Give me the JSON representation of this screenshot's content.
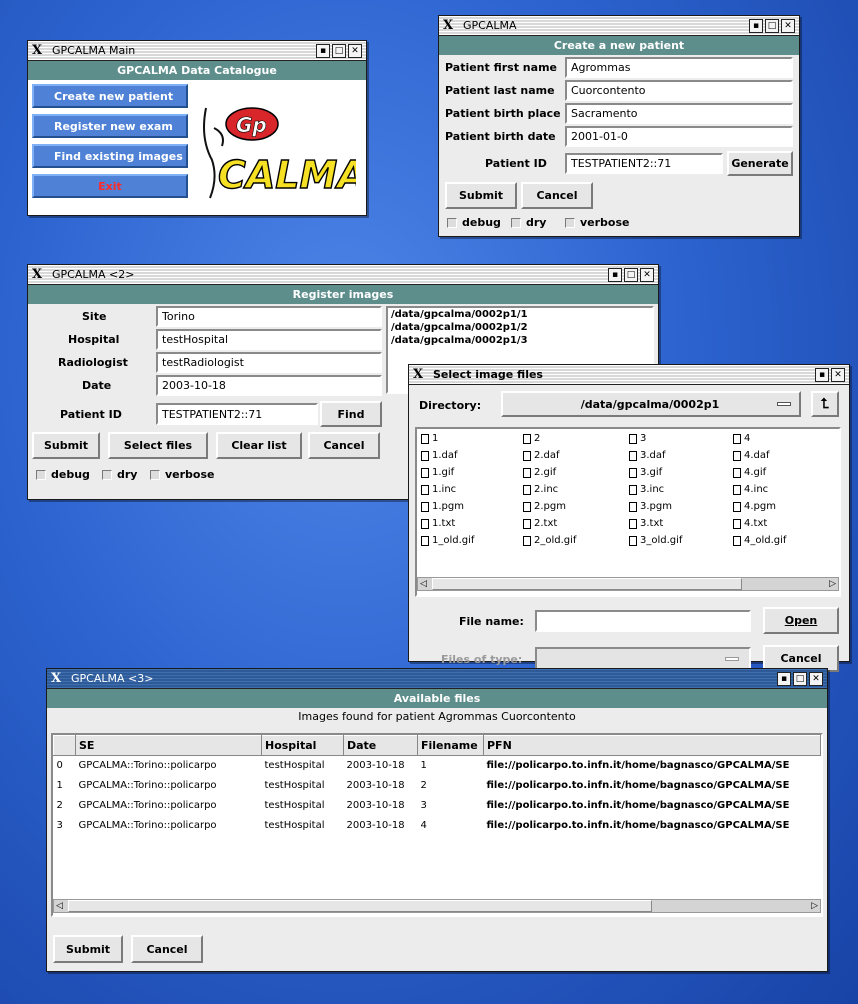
{
  "main_window": {
    "title": "GPCALMA Main",
    "band": "GPCALMA Data Catalogue",
    "buttons": [
      "Create new patient",
      "Register new exam",
      "Find existing images",
      "Exit"
    ],
    "logo_text": [
      "Gp",
      "CALMA"
    ]
  },
  "create_patient": {
    "title": "GPCALMA",
    "band": "Create a new patient",
    "fields": [
      {
        "label": "Patient first name",
        "value": "Agrommas"
      },
      {
        "label": "Patient last name",
        "value": "Cuorcontento"
      },
      {
        "label": "Patient birth place",
        "value": "Sacramento"
      },
      {
        "label": "Patient birth date",
        "value": "2001-01-0"
      }
    ],
    "patient_id": {
      "label": "Patient ID",
      "value": "TESTPATIENT2::71"
    },
    "generate_label": "Generate",
    "submit_label": "Submit",
    "cancel_label": "Cancel",
    "checks": [
      "debug",
      "dry",
      "verbose"
    ]
  },
  "register_images": {
    "title": "GPCALMA <2>",
    "band": "Register images",
    "fields": [
      {
        "label": "Site",
        "value": "Torino"
      },
      {
        "label": "Hospital",
        "value": "testHospital"
      },
      {
        "label": "Radiologist",
        "value": "testRadiologist"
      },
      {
        "label": "Date",
        "value": "2003-10-18"
      }
    ],
    "patient_id": {
      "label": "Patient ID",
      "value": "TESTPATIENT2::71"
    },
    "find_label": "Find",
    "files": [
      "/data/gpcalma/0002p1/1",
      "/data/gpcalma/0002p1/2",
      "/data/gpcalma/0002p1/3"
    ],
    "buttons": [
      "Submit",
      "Select files",
      "Clear list",
      "Cancel"
    ],
    "checks": [
      "debug",
      "dry",
      "verbose"
    ]
  },
  "select_files": {
    "title": "Select image files",
    "directory_label": "Directory:",
    "directory_value": "/data/gpcalma/0002p1",
    "columns": [
      [
        "1",
        "1.daf",
        "1.gif",
        "1.inc",
        "1.pgm",
        "1.txt",
        "1_old.gif"
      ],
      [
        "2",
        "2.daf",
        "2.gif",
        "2.inc",
        "2.pgm",
        "2.txt",
        "2_old.gif"
      ],
      [
        "3",
        "3.daf",
        "3.gif",
        "3.inc",
        "3.pgm",
        "3.txt",
        "3_old.gif"
      ],
      [
        "4",
        "4.daf",
        "4.gif",
        "4.inc",
        "4.pgm",
        "4.txt",
        "4_old.gif"
      ]
    ],
    "file_name_label": "File name:",
    "file_name_value": "",
    "files_of_type_label": "Files of type:",
    "open_label": "Open",
    "cancel_label": "Cancel"
  },
  "available_files": {
    "title": "GPCALMA <3>",
    "band": "Available files",
    "subtitle": "Images found for patient Agrommas Cuorcontento",
    "headers": [
      "",
      "SE",
      "Hospital",
      "Date",
      "Filename",
      "PFN"
    ],
    "rows": [
      [
        "0",
        "GPCALMA::Torino::policarpo",
        "testHospital",
        "2003-10-18",
        "1",
        "file://policarpo.to.infn.it/home/bagnasco/GPCALMA/SE"
      ],
      [
        "1",
        "GPCALMA::Torino::policarpo",
        "testHospital",
        "2003-10-18",
        "2",
        "file://policarpo.to.infn.it/home/bagnasco/GPCALMA/SE"
      ],
      [
        "2",
        "GPCALMA::Torino::policarpo",
        "testHospital",
        "2003-10-18",
        "3",
        "file://policarpo.to.infn.it/home/bagnasco/GPCALMA/SE"
      ],
      [
        "3",
        "GPCALMA::Torino::policarpo",
        "testHospital",
        "2003-10-18",
        "4",
        "file://policarpo.to.infn.it/home/bagnasco/GPCALMA/SE"
      ]
    ],
    "submit_label": "Submit",
    "cancel_label": "Cancel"
  }
}
